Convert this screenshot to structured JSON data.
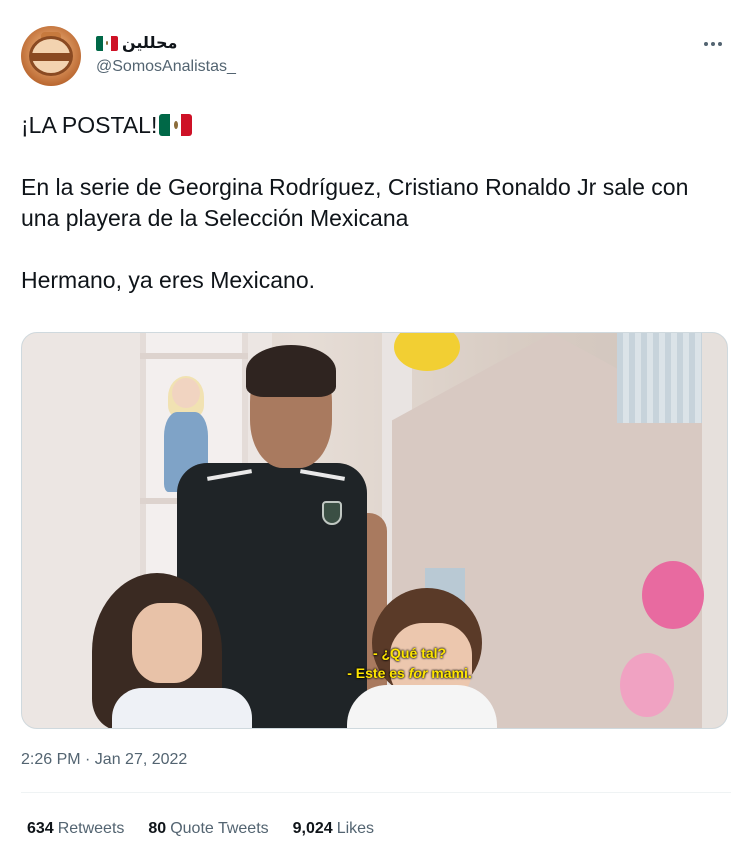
{
  "tweet": {
    "author": {
      "display_name": "محللين",
      "flag": "mexico-flag",
      "handle": "@SomosAnalistas_"
    },
    "text": {
      "line1": "¡LA POSTAL!",
      "paragraph2": "En la serie de Georgina Rodríguez, Cristiano Ronaldo Jr sale con una playera de la Selección Mexicana",
      "paragraph3": "Hermano, ya eres Mexicano."
    },
    "media": {
      "subtitle_line1": "- ¿Qué tal?",
      "subtitle_line2_pre": "- Este es ",
      "subtitle_line2_em": "for",
      "subtitle_line2_post": " mami."
    },
    "timestamp": "2:26 PM · Jan 27, 2022",
    "stats": {
      "retweets_count": "634",
      "retweets_label": "Retweets",
      "quotes_count": "80",
      "quotes_label": "Quote Tweets",
      "likes_count": "9,024",
      "likes_label": "Likes"
    }
  },
  "colors": {
    "text": "#0f1419",
    "secondary": "#536471",
    "subtitle": "#ffe600",
    "flag_green": "#006847",
    "flag_red": "#ce1126"
  }
}
